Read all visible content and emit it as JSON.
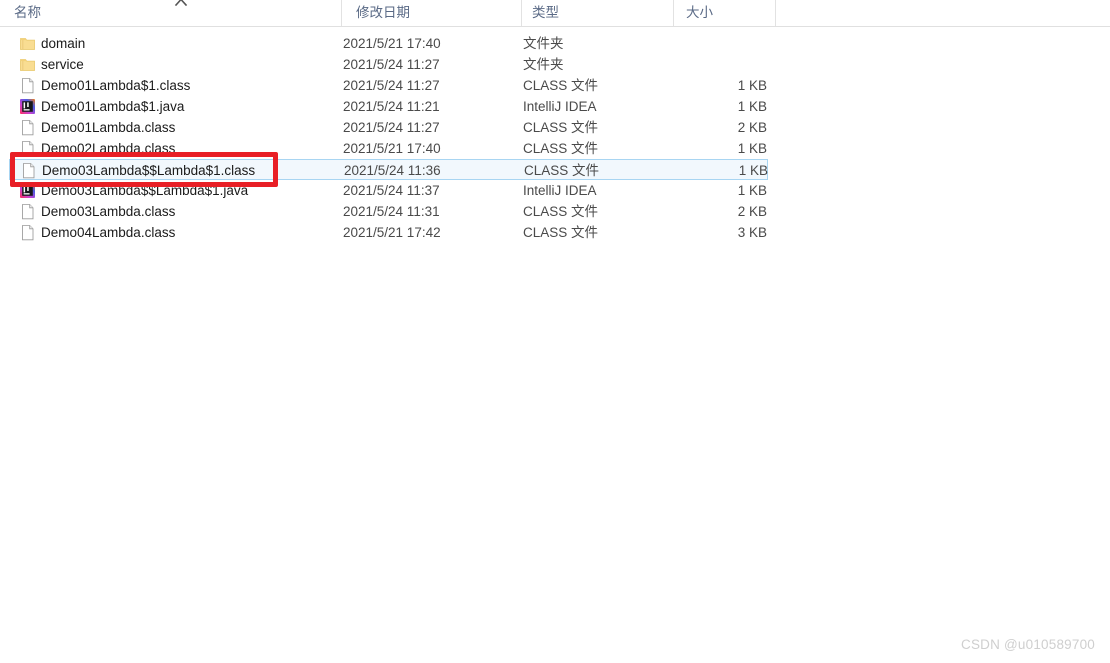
{
  "colors": {
    "annotation": "#e81f26",
    "selection_fill": "#f2f8fd",
    "selection_border": "#a8d5f2",
    "header_text": "#5a6a86",
    "folder_icon": "#f7d98b",
    "watermark": "#cfcfcf"
  },
  "header": {
    "columns": [
      {
        "label": "名称",
        "key": "name",
        "sorted": true,
        "sort_direction": "ascending"
      },
      {
        "label": "修改日期",
        "key": "date",
        "sorted": false,
        "sort_direction": ""
      },
      {
        "label": "类型",
        "key": "type",
        "sorted": false,
        "sort_direction": ""
      },
      {
        "label": "大小",
        "key": "size",
        "sorted": false,
        "sort_direction": ""
      }
    ],
    "sort_indicator_icon": "chevron-up-icon"
  },
  "rows": [
    {
      "name": "domain",
      "date": "2021/5/21 17:40",
      "type": "文件夹",
      "size": "",
      "icon": "folder-icon",
      "selected": false
    },
    {
      "name": "service",
      "date": "2021/5/24 11:27",
      "type": "文件夹",
      "size": "",
      "icon": "folder-icon",
      "selected": false
    },
    {
      "name": "Demo01Lambda$1.class",
      "date": "2021/5/24 11:27",
      "type": "CLASS 文件",
      "size": "1 KB",
      "icon": "generic-file-icon",
      "selected": false
    },
    {
      "name": "Demo01Lambda$1.java",
      "date": "2021/5/24 11:21",
      "type": "IntelliJ IDEA",
      "size": "1 KB",
      "icon": "intellij-idea-icon",
      "selected": false
    },
    {
      "name": "Demo01Lambda.class",
      "date": "2021/5/24 11:27",
      "type": "CLASS 文件",
      "size": "2 KB",
      "icon": "generic-file-icon",
      "selected": false
    },
    {
      "name": "Demo02Lambda.class",
      "date": "2021/5/21 17:40",
      "type": "CLASS 文件",
      "size": "1 KB",
      "icon": "generic-file-icon",
      "selected": false
    },
    {
      "name": "Demo03Lambda$$Lambda$1.class",
      "date": "2021/5/24 11:36",
      "type": "CLASS 文件",
      "size": "1 KB",
      "icon": "generic-file-icon",
      "selected": true
    },
    {
      "name": "Demo03Lambda$$Lambda$1.java",
      "date": "2021/5/24 11:37",
      "type": "IntelliJ IDEA",
      "size": "1 KB",
      "icon": "intellij-idea-icon",
      "selected": false
    },
    {
      "name": "Demo03Lambda.class",
      "date": "2021/5/24 11:31",
      "type": "CLASS 文件",
      "size": "2 KB",
      "icon": "generic-file-icon",
      "selected": false
    },
    {
      "name": "Demo04Lambda.class",
      "date": "2021/5/21 17:42",
      "type": "CLASS 文件",
      "size": "3 KB",
      "icon": "generic-file-icon",
      "selected": false
    }
  ],
  "annotation": {
    "shape": "rectangle",
    "target_row_name": "Demo03Lambda$$Lambda$1.class"
  },
  "watermark": {
    "text": "CSDN @u010589700"
  }
}
